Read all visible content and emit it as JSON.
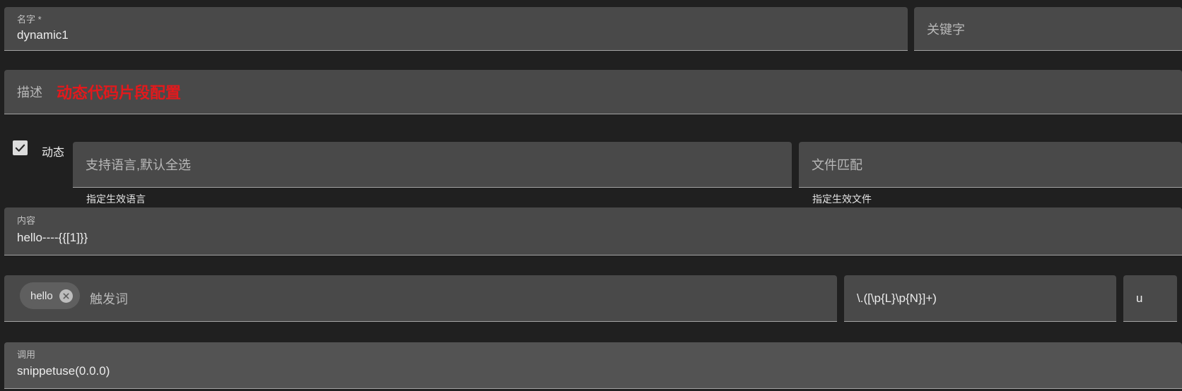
{
  "name_field": {
    "label": "名字 *",
    "value": "dynamic1"
  },
  "keyword_field": {
    "placeholder": "关键字"
  },
  "description_field": {
    "placeholder": "描述",
    "value": "动态代码片段配置",
    "value_color": "#e3191c"
  },
  "dynamic_toggle": {
    "label": "动态",
    "checked": true
  },
  "language_field": {
    "placeholder": "支持语言,默认全选",
    "helper": "指定生效语言"
  },
  "file_match_field": {
    "placeholder": "文件匹配",
    "helper": "指定生效文件"
  },
  "content_field": {
    "label": "内容",
    "value": "hello----{{[1]}}"
  },
  "trigger_field": {
    "chips": [
      {
        "label": "hello"
      }
    ],
    "placeholder": "触发词"
  },
  "regex_field": {
    "value": "\\.([\\p{L}\\p{N}]+)"
  },
  "flags_field": {
    "value": "u"
  },
  "invoke_field": {
    "label": "调用",
    "value": "snippetuse(0.0.0)"
  },
  "colors": {
    "background": "#202020",
    "field_bg": "#494949",
    "accent_red": "#e3191c"
  }
}
